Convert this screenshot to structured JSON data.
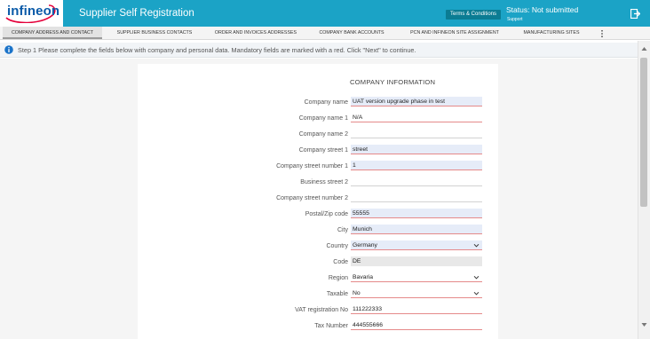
{
  "header": {
    "logo_text": "infineon",
    "app_title": "Supplier Self Registration",
    "terms_label": "Terms & Conditions",
    "status_text": "Status: Not submitted",
    "support_label": "Support",
    "logout_icon": "logout-icon",
    "color": "#1ba3c6"
  },
  "tabs": [
    {
      "label": "COMPANY ADDRESS AND CONTACT",
      "active": true
    },
    {
      "label": "SUPPLIER BUSINESS CONTACTS",
      "active": false
    },
    {
      "label": "ORDER AND INVOICES ADDRESSES",
      "active": false
    },
    {
      "label": "COMPANY BANK ACCOUNTS",
      "active": false
    },
    {
      "label": "PCN AND INFINEON SITE ASSIGNMENT",
      "active": false
    },
    {
      "label": "MANUFACTURING SITES",
      "active": false
    }
  ],
  "info": {
    "icon": "info-icon",
    "text": "Step 1 Please complete the fields below with company and personal data. Mandatory fields are marked with a red. Click \"Next\" to continue."
  },
  "form": {
    "section_title": "COMPANY INFORMATION",
    "fields": [
      {
        "label": "Company name",
        "value": "UAT version upgrade phase in test"
      },
      {
        "label": "Company name 1",
        "value": "N/A"
      },
      {
        "label": "Company name 2",
        "value": ""
      },
      {
        "label": "Company street 1",
        "value": "street"
      },
      {
        "label": "Company street number 1",
        "value": "1"
      },
      {
        "label": "Business street 2",
        "value": ""
      },
      {
        "label": "Company street number 2",
        "value": ""
      },
      {
        "label": "Postal/Zip code",
        "value": "55555"
      },
      {
        "label": "City",
        "value": "Munich"
      },
      {
        "label": "Country",
        "value": "Germany"
      },
      {
        "label": "Code",
        "value": "DE"
      },
      {
        "label": "Region",
        "value": "Bavaria"
      },
      {
        "label": "Taxable",
        "value": "No"
      },
      {
        "label": "VAT registration No",
        "value": "111222333"
      },
      {
        "label": "Tax Number",
        "value": "444555666"
      }
    ]
  }
}
